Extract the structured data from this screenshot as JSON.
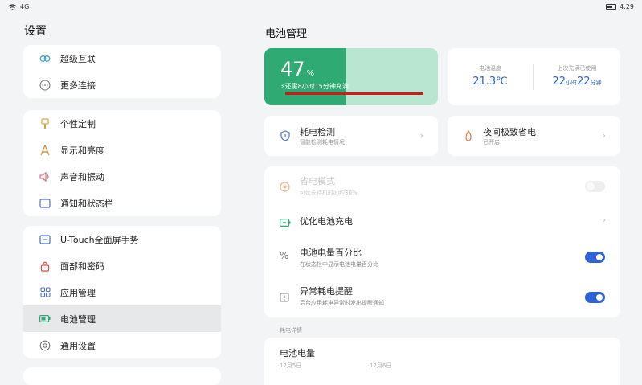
{
  "status_bar": {
    "signal_text": "4G",
    "time": "4:29"
  },
  "left_panel": {
    "title": "设置",
    "groups": [
      {
        "items": [
          {
            "label": "超级互联",
            "icon": "link-icon"
          },
          {
            "label": "更多连接",
            "icon": "more-connect-icon"
          }
        ]
      },
      {
        "items": [
          {
            "label": "个性定制",
            "icon": "brush-icon"
          },
          {
            "label": "显示和亮度",
            "icon": "brightness-icon"
          },
          {
            "label": "声音和振动",
            "icon": "sound-icon"
          },
          {
            "label": "通知和状态栏",
            "icon": "notification-icon"
          }
        ]
      },
      {
        "items": [
          {
            "label": "U-Touch全面屏手势",
            "icon": "gesture-icon"
          },
          {
            "label": "面部和密码",
            "icon": "lock-icon"
          },
          {
            "label": "应用管理",
            "icon": "apps-icon"
          },
          {
            "label": "电池管理",
            "icon": "battery-icon",
            "active": true
          },
          {
            "label": "通用设置",
            "icon": "settings-icon"
          }
        ]
      }
    ]
  },
  "right_panel": {
    "title": "电池管理",
    "battery": {
      "percent_value": "47",
      "percent_unit": "%",
      "level": 0.47,
      "remaining_text": "还需8小时15分钟充满"
    },
    "info": {
      "temp_label": "电池温度",
      "temp_value": "21.3℃",
      "since_label": "上次充满已使用",
      "since_hours": "22",
      "since_hours_unit": "小时",
      "since_minutes": "22",
      "since_minutes_unit": "分钟"
    },
    "tiles": [
      {
        "title": "耗电检测",
        "subtitle": "智能检测耗电情况",
        "icon": "shield-icon"
      },
      {
        "title": "夜间极致省电",
        "subtitle": "已开启",
        "icon": "flame-icon"
      }
    ],
    "rows": [
      {
        "title": "省电模式",
        "subtitle": "可延长待机时间约30%",
        "control": "toggle-off",
        "disabled": true,
        "icon": "power-save-icon"
      },
      {
        "title": "优化电池充电",
        "subtitle": "",
        "control": "chevron",
        "icon": "battery-charge-icon"
      },
      {
        "title": "电池电量百分比",
        "subtitle": "在状态栏中显示电池电量百分比",
        "control": "toggle-on",
        "icon": "percent-icon"
      },
      {
        "title": "异常耗电提醒",
        "subtitle": "后台应用耗电异常时发出提醒通知",
        "control": "toggle-on",
        "icon": "alert-icon"
      }
    ],
    "section_label": "耗电详情",
    "chart": {
      "title": "电池电量",
      "dates": [
        "12月5日",
        "12月6日"
      ]
    }
  },
  "colors": {
    "accent_green": "#2eaa72",
    "light_green": "#b9e6d1",
    "accent_blue": "#2f63d5",
    "annotation_red": "#d9151c"
  }
}
